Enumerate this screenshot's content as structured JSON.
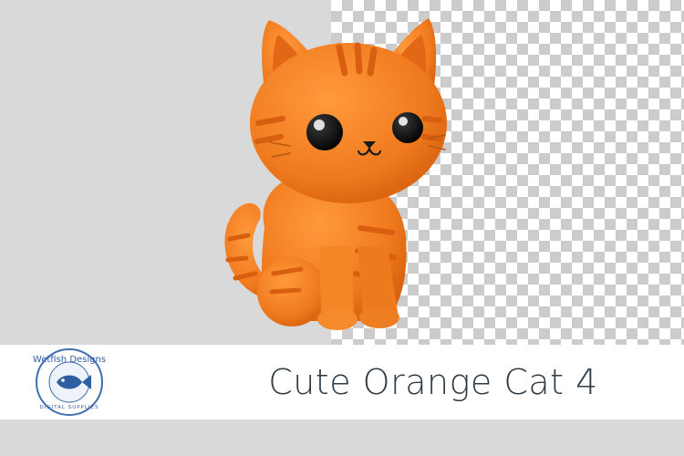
{
  "title": "Cute Orange Cat 4",
  "logo": {
    "brand": "Wetfish Designs",
    "tagline": "DIGITAL SUPPLIES"
  },
  "colors": {
    "cat_orange": "#f07a1e",
    "cat_stripe": "#d95f10",
    "title_text": "#2e3a44",
    "logo_blue": "#4a7fc1"
  }
}
